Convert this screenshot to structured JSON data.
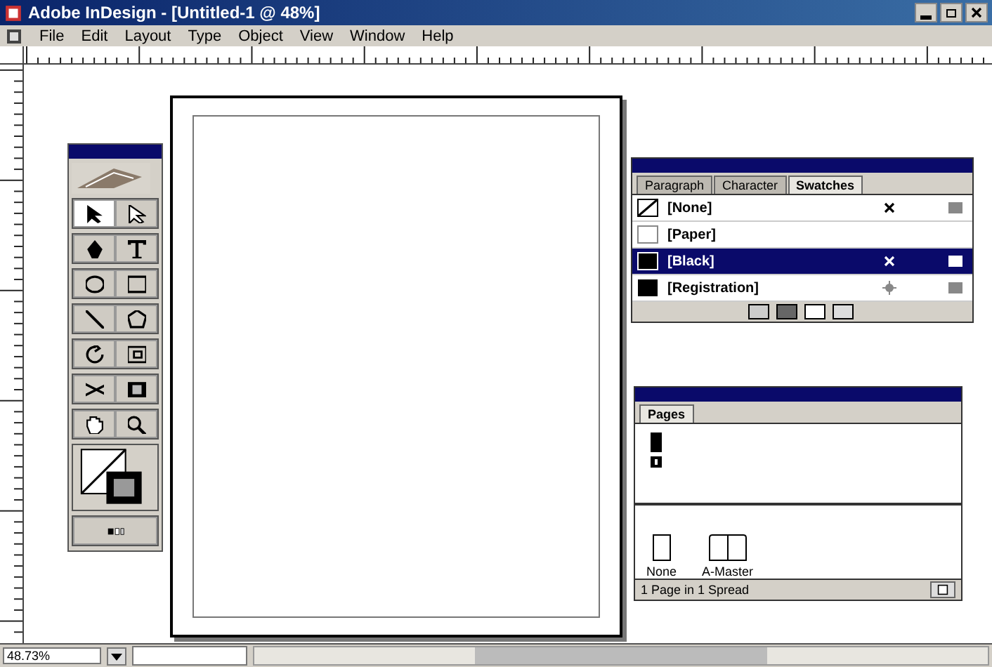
{
  "window": {
    "title": "Adobe InDesign - [Untitled-1 @ 48%]"
  },
  "menu": [
    "File",
    "Edit",
    "Layout",
    "Type",
    "Object",
    "View",
    "Window",
    "Help"
  ],
  "swatches_panel": {
    "tabs": [
      {
        "label": "Paragraph",
        "selected": false
      },
      {
        "label": "Character",
        "selected": false
      },
      {
        "label": "Swatches",
        "selected": true
      }
    ],
    "swatches": [
      {
        "name": "[None]",
        "kind": "none",
        "selected": false
      },
      {
        "name": "[Paper]",
        "kind": "paper",
        "selected": false
      },
      {
        "name": "[Black]",
        "kind": "black",
        "selected": true
      },
      {
        "name": "[Registration]",
        "kind": "registration",
        "selected": false
      }
    ]
  },
  "pages_panel": {
    "tabs": [
      {
        "label": "Pages",
        "selected": true
      }
    ],
    "masters": [
      {
        "label": "None",
        "kind": "single"
      },
      {
        "label": "A-Master",
        "kind": "spread"
      }
    ],
    "footer": "1 Page in 1 Spread"
  },
  "status_bar": {
    "zoom": "48.73%"
  }
}
